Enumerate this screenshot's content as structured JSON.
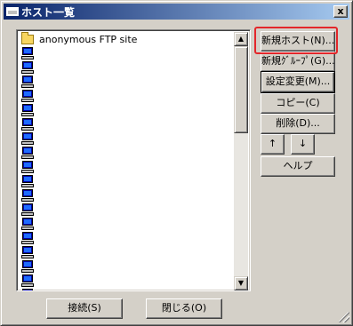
{
  "window": {
    "title": "ホスト一覧"
  },
  "titlebar": {
    "close_label": "x"
  },
  "host_list": {
    "items": [
      {
        "type": "folder",
        "label": "anonymous FTP site"
      },
      {
        "type": "host",
        "label": ""
      },
      {
        "type": "host",
        "label": ""
      },
      {
        "type": "host",
        "label": ""
      },
      {
        "type": "host",
        "label": ""
      },
      {
        "type": "host",
        "label": ""
      },
      {
        "type": "host",
        "label": ""
      },
      {
        "type": "host",
        "label": ""
      },
      {
        "type": "host",
        "label": ""
      },
      {
        "type": "host",
        "label": ""
      },
      {
        "type": "host",
        "label": ""
      },
      {
        "type": "host",
        "label": ""
      },
      {
        "type": "host",
        "label": ""
      },
      {
        "type": "host",
        "label": ""
      },
      {
        "type": "host",
        "label": ""
      },
      {
        "type": "host",
        "label": ""
      },
      {
        "type": "host",
        "label": ""
      },
      {
        "type": "host",
        "label": ""
      },
      {
        "type": "host",
        "label": ""
      }
    ],
    "scroll_up_glyph": "▲",
    "scroll_down_glyph": "▼"
  },
  "side_buttons": {
    "new_host": "新規ホスト(N)...",
    "new_group": "新規ｸﾞﾙｰﾌﾟ(G)...",
    "change_settings": "設定変更(M)...",
    "copy": "コピー(C)",
    "delete": "削除(D)...",
    "move_up": "↑",
    "move_down": "↓",
    "help": "ヘルプ"
  },
  "bottom_buttons": {
    "connect": "接続(S)",
    "close": "閉じる(O)"
  },
  "colors": {
    "highlight": "#e3262a",
    "titlebar_start": "#0a246a",
    "titlebar_end": "#a6caf0"
  }
}
